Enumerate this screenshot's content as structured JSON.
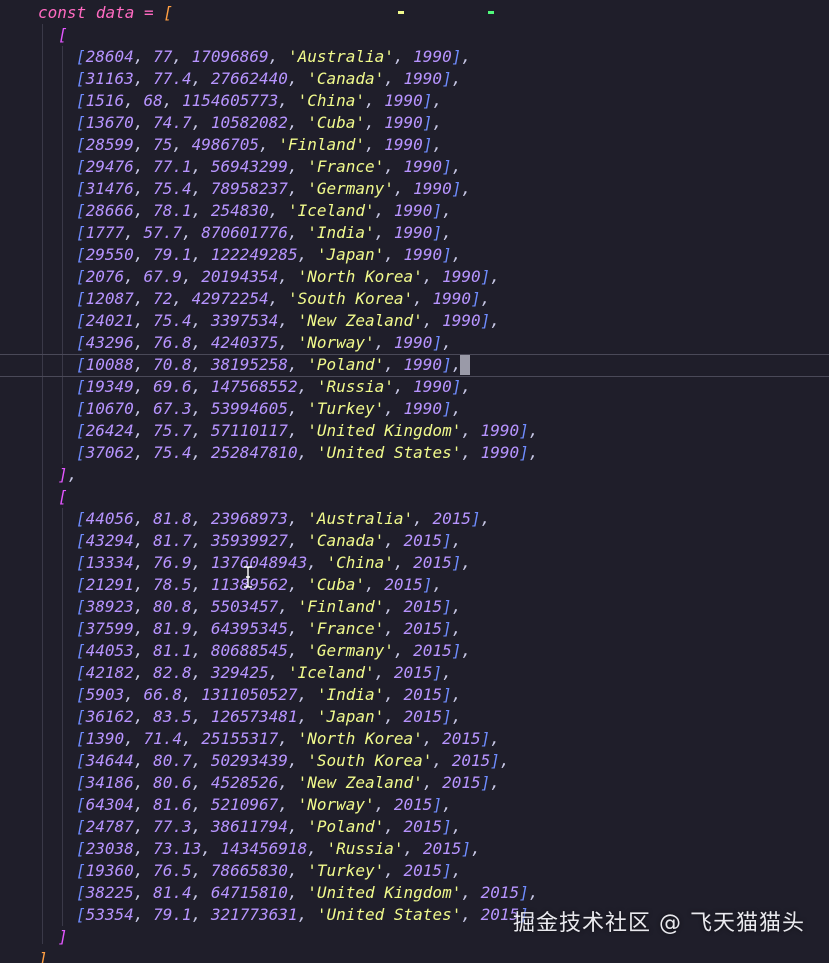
{
  "colors": {
    "background": "#1f1e2a",
    "keyword": "#ff6ac1",
    "string": "#f1fa8c",
    "number": "#b794ff",
    "bracket_outer": "#ff9f43",
    "bracket_mid": "#e256ff",
    "bracket_inner": "#6f8cff"
  },
  "code": {
    "decl_keyword": "const",
    "decl_name": "data",
    "decl_op": "=",
    "groups": [
      {
        "rows": [
          [
            "28604",
            "77",
            "17096869",
            "'Australia'",
            "1990"
          ],
          [
            "31163",
            "77.4",
            "27662440",
            "'Canada'",
            "1990"
          ],
          [
            "1516",
            "68",
            "1154605773",
            "'China'",
            "1990"
          ],
          [
            "13670",
            "74.7",
            "10582082",
            "'Cuba'",
            "1990"
          ],
          [
            "28599",
            "75",
            "4986705",
            "'Finland'",
            "1990"
          ],
          [
            "29476",
            "77.1",
            "56943299",
            "'France'",
            "1990"
          ],
          [
            "31476",
            "75.4",
            "78958237",
            "'Germany'",
            "1990"
          ],
          [
            "28666",
            "78.1",
            "254830",
            "'Iceland'",
            "1990"
          ],
          [
            "1777",
            "57.7",
            "870601776",
            "'India'",
            "1990"
          ],
          [
            "29550",
            "79.1",
            "122249285",
            "'Japan'",
            "1990"
          ],
          [
            "2076",
            "67.9",
            "20194354",
            "'North Korea'",
            "1990"
          ],
          [
            "12087",
            "72",
            "42972254",
            "'South Korea'",
            "1990"
          ],
          [
            "24021",
            "75.4",
            "3397534",
            "'New Zealand'",
            "1990"
          ],
          [
            "43296",
            "76.8",
            "4240375",
            "'Norway'",
            "1990"
          ],
          [
            "10088",
            "70.8",
            "38195258",
            "'Poland'",
            "1990"
          ],
          [
            "19349",
            "69.6",
            "147568552",
            "'Russia'",
            "1990"
          ],
          [
            "10670",
            "67.3",
            "53994605",
            "'Turkey'",
            "1990"
          ],
          [
            "26424",
            "75.7",
            "57110117",
            "'United Kingdom'",
            "1990"
          ],
          [
            "37062",
            "75.4",
            "252847810",
            "'United States'",
            "1990"
          ]
        ]
      },
      {
        "rows": [
          [
            "44056",
            "81.8",
            "23968973",
            "'Australia'",
            "2015"
          ],
          [
            "43294",
            "81.7",
            "35939927",
            "'Canada'",
            "2015"
          ],
          [
            "13334",
            "76.9",
            "1376048943",
            "'China'",
            "2015"
          ],
          [
            "21291",
            "78.5",
            "11389562",
            "'Cuba'",
            "2015"
          ],
          [
            "38923",
            "80.8",
            "5503457",
            "'Finland'",
            "2015"
          ],
          [
            "37599",
            "81.9",
            "64395345",
            "'France'",
            "2015"
          ],
          [
            "44053",
            "81.1",
            "80688545",
            "'Germany'",
            "2015"
          ],
          [
            "42182",
            "82.8",
            "329425",
            "'Iceland'",
            "2015"
          ],
          [
            "5903",
            "66.8",
            "1311050527",
            "'India'",
            "2015"
          ],
          [
            "36162",
            "83.5",
            "126573481",
            "'Japan'",
            "2015"
          ],
          [
            "1390",
            "71.4",
            "25155317",
            "'North Korea'",
            "2015"
          ],
          [
            "34644",
            "80.7",
            "50293439",
            "'South Korea'",
            "2015"
          ],
          [
            "34186",
            "80.6",
            "4528526",
            "'New Zealand'",
            "2015"
          ],
          [
            "64304",
            "81.6",
            "5210967",
            "'Norway'",
            "2015"
          ],
          [
            "24787",
            "77.3",
            "38611794",
            "'Poland'",
            "2015"
          ],
          [
            "23038",
            "73.13",
            "143456918",
            "'Russia'",
            "2015"
          ],
          [
            "19360",
            "76.5",
            "78665830",
            "'Turkey'",
            "2015"
          ],
          [
            "38225",
            "81.4",
            "64715810",
            "'United Kingdom'",
            "2015"
          ],
          [
            "53354",
            "79.1",
            "321773631",
            "'United States'",
            "2015"
          ]
        ]
      }
    ]
  },
  "watermark": "掘金技术社区 @ 飞天猫猫头"
}
